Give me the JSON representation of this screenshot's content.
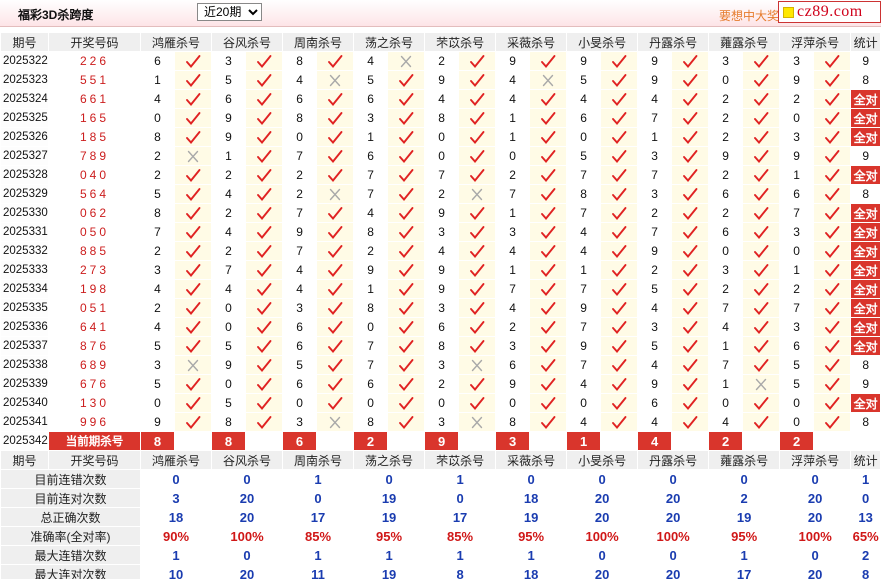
{
  "header": {
    "title": "福彩3D杀跨度",
    "period_select": "近20期",
    "slogan": "要想中大奖",
    "logo": "cz89.com"
  },
  "columns": {
    "period": "期号",
    "number": "开奖号码",
    "experts": [
      "鸿雁杀号",
      "谷风杀号",
      "周南杀号",
      "荡之杀号",
      "芣苡杀号",
      "采薇杀号",
      "小旻杀号",
      "丹露杀号",
      "蕹露杀号",
      "浮萍杀号"
    ],
    "stat": "统计"
  },
  "all_right_label": "全对",
  "rows": [
    {
      "period": "2025322",
      "number": "226",
      "kills": [
        "6",
        "3",
        "8",
        "4",
        "2",
        "9",
        "9",
        "9",
        "3",
        "3"
      ],
      "marks": [
        "right",
        "right",
        "right",
        "wrong",
        "right",
        "right",
        "right",
        "right",
        "right",
        "right"
      ],
      "stat": "9"
    },
    {
      "period": "2025323",
      "number": "551",
      "kills": [
        "1",
        "5",
        "4",
        "5",
        "9",
        "4",
        "5",
        "9",
        "0",
        "9"
      ],
      "marks": [
        "right",
        "right",
        "wrong",
        "right",
        "right",
        "wrong",
        "right",
        "right",
        "right",
        "right"
      ],
      "stat": "8"
    },
    {
      "period": "2025324",
      "number": "661",
      "kills": [
        "4",
        "6",
        "6",
        "6",
        "4",
        "4",
        "4",
        "4",
        "2",
        "2"
      ],
      "marks": [
        "right",
        "right",
        "right",
        "right",
        "right",
        "right",
        "right",
        "right",
        "right",
        "right"
      ],
      "stat": "全对"
    },
    {
      "period": "2025325",
      "number": "165",
      "kills": [
        "0",
        "9",
        "8",
        "3",
        "8",
        "1",
        "6",
        "7",
        "2",
        "0"
      ],
      "marks": [
        "right",
        "right",
        "right",
        "right",
        "right",
        "right",
        "right",
        "right",
        "right",
        "right"
      ],
      "stat": "全对"
    },
    {
      "period": "2025326",
      "number": "185",
      "kills": [
        "8",
        "9",
        "0",
        "1",
        "0",
        "1",
        "0",
        "1",
        "2",
        "3"
      ],
      "marks": [
        "right",
        "right",
        "right",
        "right",
        "right",
        "right",
        "right",
        "right",
        "right",
        "right"
      ],
      "stat": "全对"
    },
    {
      "period": "2025327",
      "number": "789",
      "kills": [
        "2",
        "1",
        "7",
        "6",
        "0",
        "0",
        "5",
        "3",
        "9",
        "9"
      ],
      "marks": [
        "wrong",
        "right",
        "right",
        "right",
        "right",
        "right",
        "right",
        "right",
        "right",
        "right"
      ],
      "stat": "9"
    },
    {
      "period": "2025328",
      "number": "040",
      "kills": [
        "2",
        "2",
        "2",
        "7",
        "7",
        "2",
        "7",
        "7",
        "2",
        "1"
      ],
      "marks": [
        "right",
        "right",
        "right",
        "right",
        "right",
        "right",
        "right",
        "right",
        "right",
        "right"
      ],
      "stat": "全对"
    },
    {
      "period": "2025329",
      "number": "564",
      "kills": [
        "5",
        "4",
        "2",
        "7",
        "2",
        "7",
        "8",
        "3",
        "6",
        "6"
      ],
      "marks": [
        "right",
        "right",
        "wrong",
        "right",
        "wrong",
        "right",
        "right",
        "right",
        "right",
        "right"
      ],
      "stat": "8"
    },
    {
      "period": "2025330",
      "number": "062",
      "kills": [
        "8",
        "2",
        "7",
        "4",
        "9",
        "1",
        "7",
        "2",
        "2",
        "7"
      ],
      "marks": [
        "right",
        "right",
        "right",
        "right",
        "right",
        "right",
        "right",
        "right",
        "right",
        "right"
      ],
      "stat": "全对"
    },
    {
      "period": "2025331",
      "number": "050",
      "kills": [
        "7",
        "4",
        "9",
        "8",
        "3",
        "3",
        "4",
        "7",
        "6",
        "3"
      ],
      "marks": [
        "right",
        "right",
        "right",
        "right",
        "right",
        "right",
        "right",
        "right",
        "right",
        "right"
      ],
      "stat": "全对"
    },
    {
      "period": "2025332",
      "number": "885",
      "kills": [
        "2",
        "2",
        "7",
        "2",
        "4",
        "4",
        "4",
        "9",
        "0",
        "0"
      ],
      "marks": [
        "right",
        "right",
        "right",
        "right",
        "right",
        "right",
        "right",
        "right",
        "right",
        "right"
      ],
      "stat": "全对"
    },
    {
      "period": "2025333",
      "number": "273",
      "kills": [
        "3",
        "7",
        "4",
        "9",
        "9",
        "1",
        "1",
        "2",
        "3",
        "1"
      ],
      "marks": [
        "right",
        "right",
        "right",
        "right",
        "right",
        "right",
        "right",
        "right",
        "right",
        "right"
      ],
      "stat": "全对"
    },
    {
      "period": "2025334",
      "number": "198",
      "kills": [
        "4",
        "4",
        "4",
        "1",
        "9",
        "7",
        "7",
        "5",
        "2",
        "2"
      ],
      "marks": [
        "right",
        "right",
        "right",
        "right",
        "right",
        "right",
        "right",
        "right",
        "right",
        "right"
      ],
      "stat": "全对"
    },
    {
      "period": "2025335",
      "number": "051",
      "kills": [
        "2",
        "0",
        "3",
        "8",
        "3",
        "4",
        "9",
        "4",
        "7",
        "7"
      ],
      "marks": [
        "right",
        "right",
        "right",
        "right",
        "right",
        "right",
        "right",
        "right",
        "right",
        "right"
      ],
      "stat": "全对"
    },
    {
      "period": "2025336",
      "number": "641",
      "kills": [
        "4",
        "0",
        "6",
        "0",
        "6",
        "2",
        "7",
        "3",
        "4",
        "3"
      ],
      "marks": [
        "right",
        "right",
        "right",
        "right",
        "right",
        "right",
        "right",
        "right",
        "right",
        "right"
      ],
      "stat": "全对"
    },
    {
      "period": "2025337",
      "number": "876",
      "kills": [
        "5",
        "5",
        "6",
        "7",
        "8",
        "3",
        "9",
        "5",
        "1",
        "6"
      ],
      "marks": [
        "right",
        "right",
        "right",
        "right",
        "right",
        "right",
        "right",
        "right",
        "right",
        "right"
      ],
      "stat": "全对"
    },
    {
      "period": "2025338",
      "number": "689",
      "kills": [
        "3",
        "9",
        "5",
        "7",
        "3",
        "6",
        "7",
        "4",
        "7",
        "5"
      ],
      "marks": [
        "wrong",
        "right",
        "right",
        "right",
        "wrong",
        "right",
        "right",
        "right",
        "right",
        "right"
      ],
      "stat": "8"
    },
    {
      "period": "2025339",
      "number": "676",
      "kills": [
        "5",
        "0",
        "6",
        "6",
        "2",
        "9",
        "4",
        "9",
        "1",
        "5"
      ],
      "marks": [
        "right",
        "right",
        "right",
        "right",
        "right",
        "right",
        "right",
        "right",
        "wrong",
        "right"
      ],
      "stat": "9"
    },
    {
      "period": "2025340",
      "number": "130",
      "kills": [
        "0",
        "5",
        "0",
        "0",
        "0",
        "0",
        "0",
        "6",
        "0",
        "0"
      ],
      "marks": [
        "right",
        "right",
        "right",
        "right",
        "right",
        "right",
        "right",
        "right",
        "right",
        "right"
      ],
      "stat": "全对"
    },
    {
      "period": "2025341",
      "number": "996",
      "kills": [
        "9",
        "8",
        "3",
        "8",
        "3",
        "8",
        "4",
        "4",
        "4",
        "0"
      ],
      "marks": [
        "right",
        "right",
        "wrong",
        "right",
        "wrong",
        "right",
        "right",
        "right",
        "right",
        "right"
      ],
      "stat": "8"
    }
  ],
  "current": {
    "period": "2025342",
    "label": "当前期杀号",
    "kills": [
      "8",
      "8",
      "6",
      "2",
      "9",
      "3",
      "1",
      "4",
      "2",
      "2"
    ]
  },
  "stats": [
    {
      "label": "目前连错次数",
      "values": [
        "0",
        "0",
        "1",
        "0",
        "1",
        "0",
        "0",
        "0",
        "0",
        "0"
      ],
      "total": "1",
      "color": "blue"
    },
    {
      "label": "目前连对次数",
      "values": [
        "3",
        "20",
        "0",
        "19",
        "0",
        "18",
        "20",
        "20",
        "2",
        "20"
      ],
      "total": "0",
      "color": "blue"
    },
    {
      "label": "总正确次数",
      "values": [
        "18",
        "20",
        "17",
        "19",
        "17",
        "19",
        "20",
        "20",
        "19",
        "20"
      ],
      "total": "13",
      "color": "blue"
    },
    {
      "label": "准确率(全对率)",
      "values": [
        "90%",
        "100%",
        "85%",
        "95%",
        "85%",
        "95%",
        "100%",
        "100%",
        "95%",
        "100%"
      ],
      "total": "65%",
      "color": "red"
    },
    {
      "label": "最大连错次数",
      "values": [
        "1",
        "0",
        "1",
        "1",
        "1",
        "1",
        "0",
        "0",
        "1",
        "0"
      ],
      "total": "2",
      "color": "blue"
    },
    {
      "label": "最大连对次数",
      "values": [
        "10",
        "20",
        "11",
        "19",
        "8",
        "18",
        "20",
        "20",
        "17",
        "20"
      ],
      "total": "8",
      "color": "blue"
    }
  ]
}
